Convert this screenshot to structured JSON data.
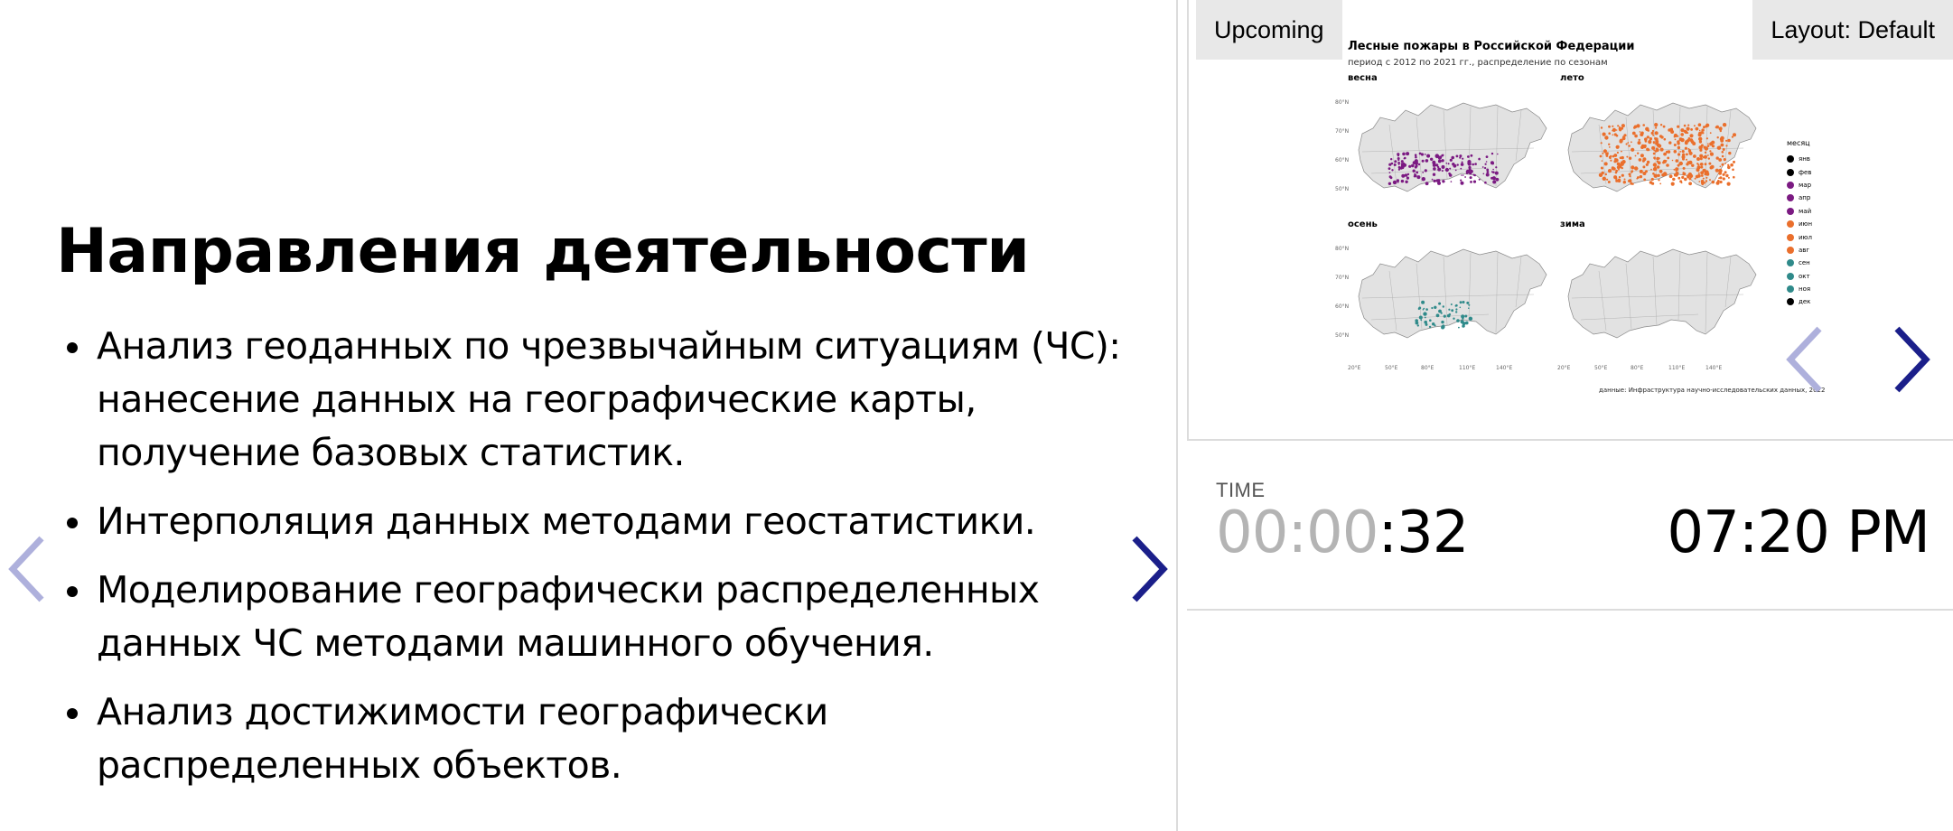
{
  "slide": {
    "title": "Направления деятельности",
    "bullets": [
      [
        "Анализ геоданных по чрезвычайным ситуациям (ЧС):",
        "нанесение данных на географические карты,",
        "получение базовых статистик."
      ],
      [
        "Интерполяция данных методами геостатистики."
      ],
      [
        "Моделирование географически распределенных",
        "данных ЧС методами машинного обучения."
      ],
      [
        "Анализ достижимости географически",
        "распределенных объектов."
      ]
    ]
  },
  "upcoming": {
    "label": "Upcoming",
    "layout_label": "Layout: Default",
    "figure": {
      "title": "Лесные пожары в Российской Федерации",
      "subtitle": "период с 2012 по 2021 гг., распределение по сезонам",
      "seasons": [
        "весна",
        "лето",
        "осень",
        "зима"
      ],
      "lat_labels": [
        "80°N",
        "70°N",
        "60°N",
        "50°N"
      ],
      "lon_labels": [
        "20°E",
        "50°E",
        "80°E",
        "110°E",
        "140°E"
      ],
      "legend_title": "месяц",
      "months": [
        "янв",
        "фев",
        "мар",
        "апр",
        "май",
        "июн",
        "июл",
        "авг",
        "сен",
        "окт",
        "ноя",
        "дек"
      ],
      "month_colors": [
        "#000000",
        "#000000",
        "#7b1a82",
        "#7b1a82",
        "#7b1a82",
        "#ea6f2c",
        "#ea6f2c",
        "#ea6f2c",
        "#2f8a8a",
        "#2f8a8a",
        "#2f8a8a",
        "#000000"
      ],
      "source": "данные: Инфраструктура научно-исследовательских данных, 2022"
    }
  },
  "time": {
    "label": "TIME",
    "elapsed_dim": "00:00",
    "elapsed_bright": ":32",
    "clock": "07:20 PM"
  },
  "colors": {
    "nav_active": "#1b1f8a",
    "nav_disabled": "#aeb0dc",
    "panel_label_bg": "#e8e8e8",
    "map_land": "#e2e2e2",
    "spring": "#7b1a82",
    "summer": "#ea6f2c",
    "autumn": "#2f8a8a"
  },
  "icons": {
    "prev": "chevron-left-icon",
    "next": "chevron-right-icon"
  }
}
